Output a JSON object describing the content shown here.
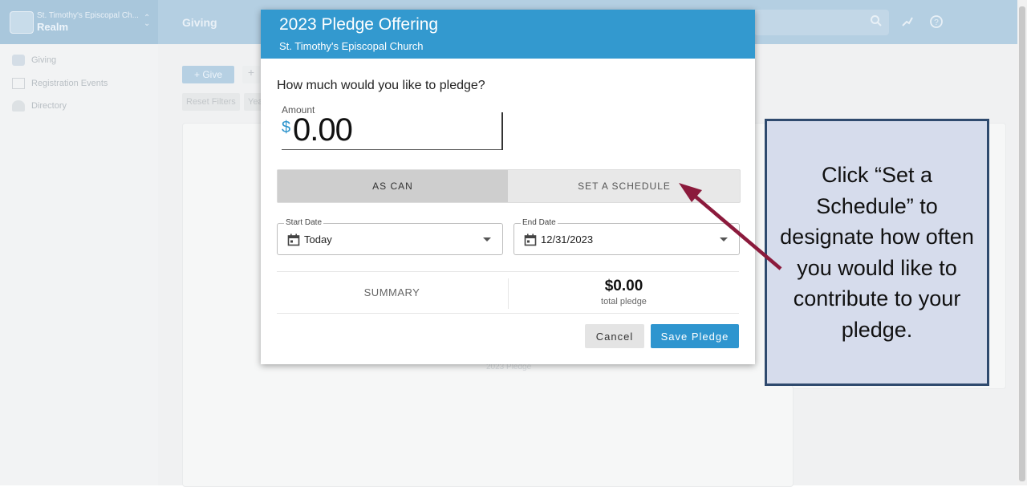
{
  "app": {
    "church_name": "St. Timothy's Episcopal Ch...",
    "product": "Realm",
    "page_title": "Giving",
    "sidebar": [
      {
        "label": "Giving",
        "icon": "giving-icon"
      },
      {
        "label": "Registration Events",
        "icon": "events-icon"
      },
      {
        "label": "Directory",
        "icon": "directory-icon"
      }
    ],
    "give_button": "+ Give",
    "ghost_button": "+",
    "chips": [
      "Reset Filters",
      "Yea"
    ],
    "faint_label": "2023 Pledge"
  },
  "dialog": {
    "title": "2023 Pledge Offering",
    "subtitle": "St. Timothy's Episcopal Church",
    "question": "How much would you like to pledge?",
    "amount_label": "Amount",
    "currency_symbol": "$",
    "amount_value": "0.00",
    "toggle": {
      "left": "AS CAN",
      "right": "SET A SCHEDULE",
      "selected": "AS CAN"
    },
    "start_date": {
      "label": "Start Date",
      "value": "Today"
    },
    "end_date": {
      "label": "End Date",
      "value": "12/31/2023"
    },
    "summary_label": "SUMMARY",
    "total_value": "$0.00",
    "total_label": "total pledge",
    "cancel_label": "Cancel",
    "save_label": "Save Pledge"
  },
  "callout": {
    "text": "Click “Set a Schedule” to designate how often you would like to contribute to your pledge."
  },
  "colors": {
    "header_blue": "#3399cf",
    "save_blue": "#2e95cf",
    "arrow": "#8b1a3c",
    "callout_bg": "#d6dcec",
    "callout_border": "#2f4a6e"
  }
}
